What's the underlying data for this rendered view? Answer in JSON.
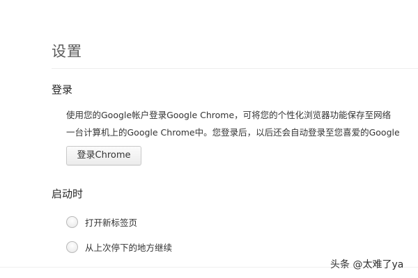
{
  "page": {
    "title": "设置"
  },
  "signin": {
    "section_title": "登录",
    "description_line1": "使用您的Google帐户登录Google Chrome，可将您的个性化浏览器功能保存至网络",
    "description_line2": "一台计算机上的Google Chrome中。您登录后，以后还会自动登录至您喜爱的Google",
    "button_label": "登录Chrome"
  },
  "startup": {
    "section_title": "启动时",
    "options": [
      {
        "label": "打开新标签页",
        "selected": false
      },
      {
        "label": "从上次停下的地方继续",
        "selected": false
      }
    ]
  },
  "watermark": "头条 @太难了ya"
}
